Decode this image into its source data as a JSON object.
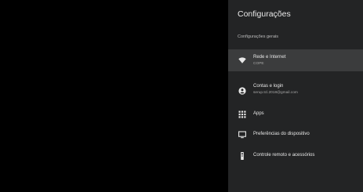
{
  "panel": {
    "title": "Configurações",
    "section_label": "Configurações gerais"
  },
  "menu": {
    "items": [
      {
        "icon": "wifi-icon",
        "label": "Rede e Internet",
        "sublabel": "COPE"
      },
      {
        "icon": "account-icon",
        "label": "Contas e login",
        "sublabel": "serup.tcl.2018@gmail.com"
      },
      {
        "icon": "apps-grid-icon",
        "label": "Apps"
      },
      {
        "icon": "tv-icon",
        "label": "Preferências do dispositivo"
      },
      {
        "icon": "remote-icon",
        "label": "Controle remoto e acessórios"
      }
    ]
  },
  "colors": {
    "background": "#000000",
    "panel": "#232425",
    "selected": "#3b3c3d",
    "text": "#e8e8e8",
    "subtext": "#a8a8a8"
  }
}
